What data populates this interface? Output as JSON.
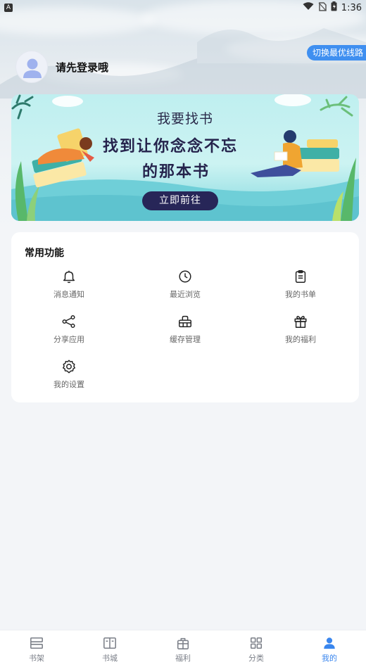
{
  "status_bar": {
    "indicator": "A",
    "time": "1:36"
  },
  "header": {
    "switch_line_label": "切换最优线路",
    "login_prompt": "请先登录哦"
  },
  "banner": {
    "subtitle": "我要找书",
    "title_line1": "找到让你念念不忘",
    "title_line2": "的那本书",
    "button_label": "立即前往"
  },
  "functions": {
    "title": "常用功能",
    "items": [
      {
        "label": "消息通知",
        "icon": "bell-icon"
      },
      {
        "label": "最近浏览",
        "icon": "clock-icon"
      },
      {
        "label": "我的书单",
        "icon": "clipboard-icon"
      },
      {
        "label": "分享应用",
        "icon": "share-icon"
      },
      {
        "label": "缓存管理",
        "icon": "basket-icon"
      },
      {
        "label": "我的福利",
        "icon": "gift-icon"
      },
      {
        "label": "我的设置",
        "icon": "gear-icon"
      }
    ]
  },
  "tabbar": {
    "active_color": "#3a86ee",
    "items": [
      {
        "label": "书架",
        "icon": "bookshelf-icon"
      },
      {
        "label": "书城",
        "icon": "open-book-icon"
      },
      {
        "label": "福利",
        "icon": "gift-box-icon"
      },
      {
        "label": "分类",
        "icon": "grid-icon"
      },
      {
        "label": "我的",
        "icon": "person-icon",
        "active": true
      }
    ]
  }
}
